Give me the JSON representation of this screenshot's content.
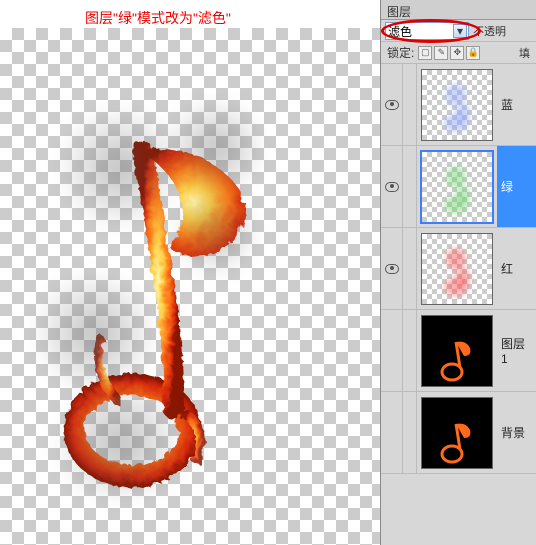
{
  "annotation": "图层\"绿\"模式改为\"滤色\"",
  "panel": {
    "tab": "图层",
    "blend_mode": "滤色",
    "opacity_label": "不透明",
    "lock_label": "锁定:",
    "fill_label": "填"
  },
  "layers": [
    {
      "name": "蓝",
      "visible": true,
      "selected": false,
      "thumb": "checker",
      "tint": "#8aa0ff"
    },
    {
      "name": "绿",
      "visible": true,
      "selected": true,
      "thumb": "checker",
      "tint": "#6ad46a"
    },
    {
      "name": "红",
      "visible": true,
      "selected": false,
      "thumb": "checker",
      "tint": "#ff4d4d"
    },
    {
      "name": "图层 1",
      "visible": false,
      "selected": false,
      "thumb": "black",
      "tint": "#ff6a1a"
    },
    {
      "name": "背景",
      "visible": false,
      "selected": false,
      "thumb": "black",
      "tint": "#ff6a1a"
    }
  ],
  "icons": {
    "lock_transparent": "▢",
    "lock_paint": "✎",
    "lock_move": "✥",
    "lock_all": "🔒"
  }
}
